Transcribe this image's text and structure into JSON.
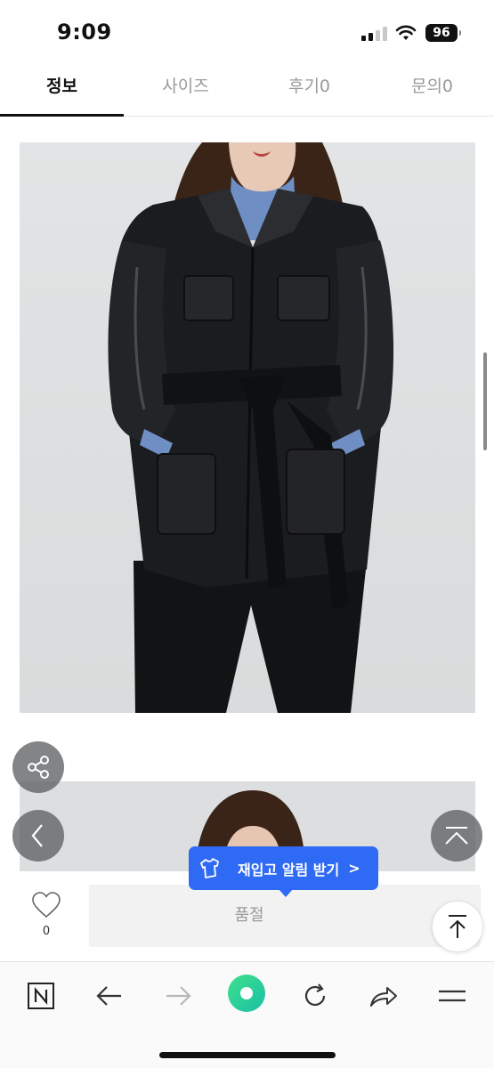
{
  "status_bar": {
    "time": "9:09",
    "battery": "96"
  },
  "tabs": [
    {
      "label": "정보",
      "active": true
    },
    {
      "label": "사이즈",
      "active": false
    },
    {
      "label": "후기0",
      "active": false
    },
    {
      "label": "문의0",
      "active": false
    }
  ],
  "restock": {
    "label": "재입고 알림 받기",
    "chevron": ">"
  },
  "purchase": {
    "like_count": "0",
    "soldout_label": "품절"
  },
  "colors": {
    "accent": "#2f6af5",
    "naver_green": "#1ec800"
  },
  "icons": [
    "share-icon",
    "chevron-left-icon",
    "scroll-top-icon",
    "heart-icon",
    "arrow-up-icon",
    "naver-icon",
    "back-arrow-icon",
    "forward-arrow-icon",
    "green-dot-icon",
    "refresh-icon",
    "share-forward-icon",
    "menu-icon"
  ]
}
